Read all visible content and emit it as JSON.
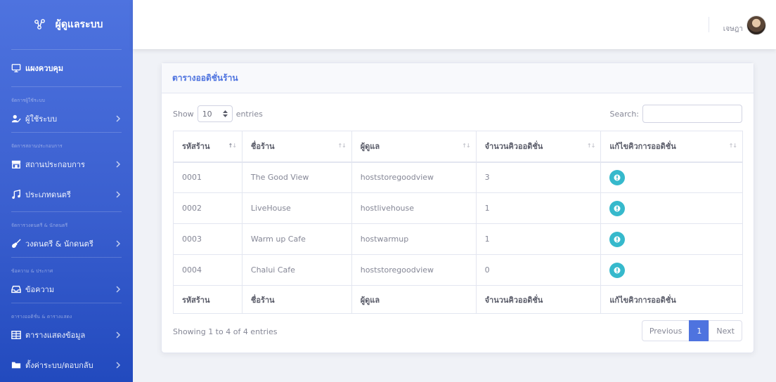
{
  "sidebar": {
    "brand": "ผู้ดูแลระบบ",
    "dashboard": "แผงควบคุม",
    "sections": [
      {
        "heading": "จัดการผู้ใช้ระบบ",
        "label": "ผู้ใช้ระบบ"
      },
      {
        "heading": "จัดการสถานประกอบการ",
        "label": "สถานประกอบการ"
      },
      {
        "heading": "",
        "label": "ประเภทดนตรี"
      },
      {
        "heading": "จัดการวงดนตรี & นักดนตรี",
        "label": "วงดนตรี & นักดนตรี"
      },
      {
        "heading": "ข้อความ & ประกาศ",
        "label": "ข้อความ"
      },
      {
        "heading": "ตารางออดิชั่น & ตารางแสดง",
        "label": "ตารางแสดงข้อมูล"
      },
      {
        "heading": "",
        "label": "ตั้งค่าระบบ/ตอบกลับ"
      }
    ]
  },
  "topbar": {
    "user_name": "เจษฎา"
  },
  "card": {
    "title": "ตารางออดิชั่นร้าน",
    "show_label": "Show",
    "entries_value": "10",
    "entries_label": "entries",
    "search_label": "Search:",
    "search_value": "",
    "columns": [
      "รหัสร้าน",
      "ชื่อร้าน",
      "ผู้ดูแล",
      "จำนวนคิวออดิชั่น",
      "แก้ไขคิวการออดิชั่น"
    ],
    "rows": [
      {
        "id": "0001",
        "name": "The Good View",
        "admin": "hoststoregoodview",
        "count": "3"
      },
      {
        "id": "0002",
        "name": "LiveHouse",
        "admin": "hostlivehouse",
        "count": "1"
      },
      {
        "id": "0003",
        "name": "Warm up Cafe",
        "admin": "hostwarmup",
        "count": "1"
      },
      {
        "id": "0004",
        "name": "Chalui Cafe",
        "admin": "hoststoregoodview",
        "count": "0"
      }
    ],
    "info": "Showing 1 to 4 of 4 entries",
    "pagination": {
      "previous": "Previous",
      "current": "1",
      "next": "Next"
    }
  },
  "colors": {
    "primary": "#4e73df",
    "info": "#36b9cc",
    "sidebar_bottom": "#224abe"
  }
}
